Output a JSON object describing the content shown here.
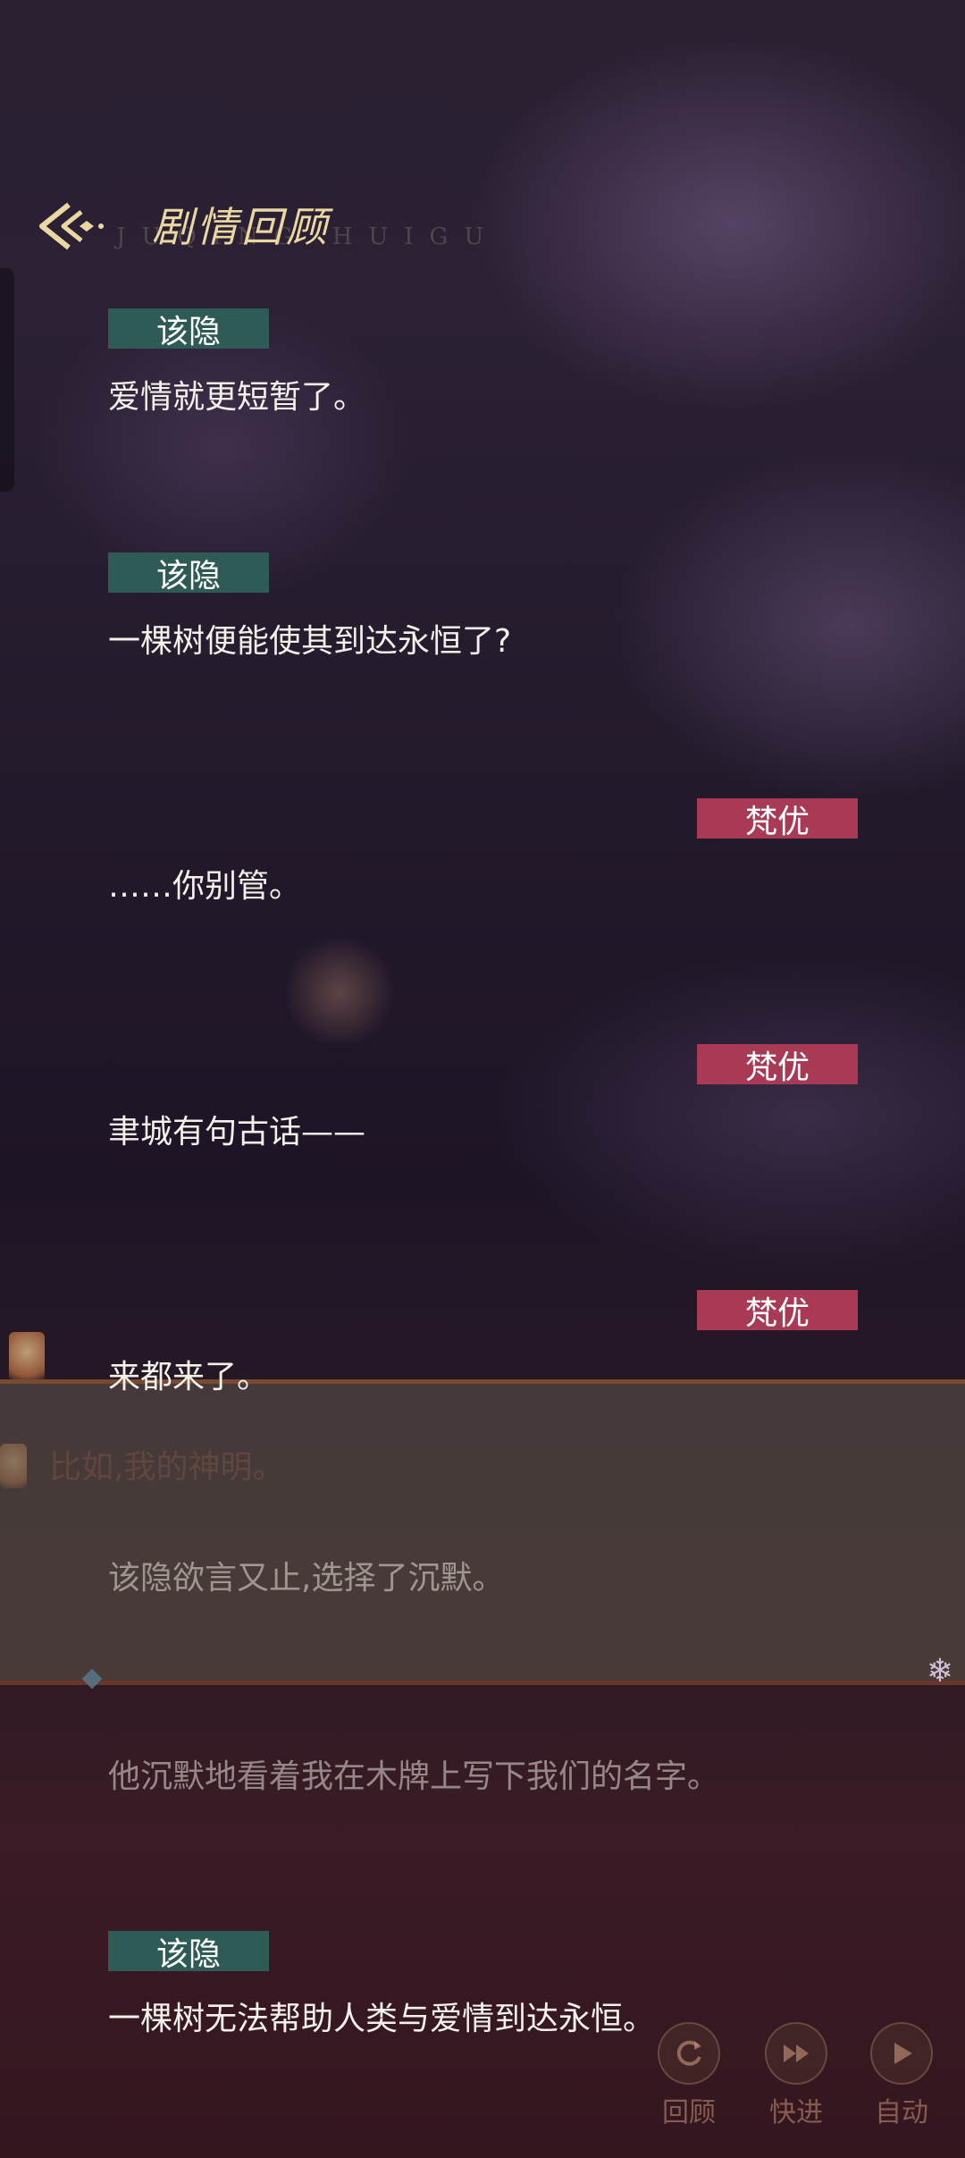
{
  "header": {
    "title": "剧情回顾",
    "title_en": "JUQING HUIGU"
  },
  "entries": [
    {
      "speaker": "该隐",
      "side": "left",
      "text": "爱情就更短暂了。"
    },
    {
      "speaker": "该隐",
      "side": "left",
      "text": "一棵树便能使其到达永恒了?"
    },
    {
      "speaker": "梵优",
      "side": "right",
      "text": "……你别管。"
    },
    {
      "speaker": "梵优",
      "side": "right",
      "text": "聿城有句古话——"
    },
    {
      "speaker": "梵优",
      "side": "right",
      "text": "来都来了。"
    },
    {
      "speaker": "",
      "side": "none",
      "text": "比如,我的神明。"
    },
    {
      "speaker": "",
      "side": "none",
      "text": "该隐欲言又止,选择了沉默。"
    },
    {
      "speaker": "",
      "side": "none",
      "text": "他沉默地看着我在木牌上写下我们的名字。"
    },
    {
      "speaker": "该隐",
      "side": "left",
      "text": "一棵树无法帮助人类与爱情到达永恒。"
    }
  ],
  "controls": {
    "review_label": "回顾",
    "skip_label": "快进",
    "auto_label": "自动"
  },
  "colors": {
    "speaker_left_bg": "#2f5b57",
    "speaker_right_bg": "#a83a55",
    "title_gold": "#ead8a2"
  },
  "icons": [
    "back-arrow-icon",
    "review-icon",
    "fast-forward-icon",
    "play-icon",
    "snowflake-icon"
  ]
}
